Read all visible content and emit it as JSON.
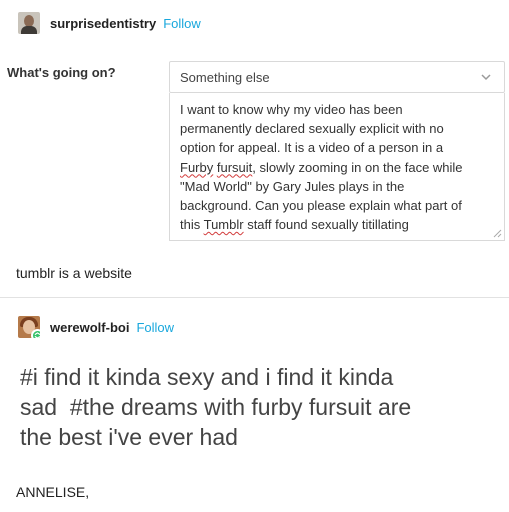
{
  "post1": {
    "username": "surprisedentistry",
    "follow_label": "Follow"
  },
  "form": {
    "label": "What's going on?",
    "select_value": "Something else",
    "message": {
      "line1": "I want to know why my video has been",
      "line2": "permanently declared sexually explicit with no",
      "line3": "option for appeal. It is a video of a person in a",
      "line4_word1": "Furby",
      "line4_word2": "fursuit",
      "line4_rest": ", slowly zooming in on the face while",
      "line5": "\"Mad World\" by Gary Jules plays in the",
      "line6": "background. Can you please explain what part of",
      "line7_pre": "this ",
      "line7_word": "Tumblr",
      "line7_rest": " staff found sexually titillating"
    }
  },
  "comment": "tumblr is a website",
  "post2": {
    "username": "werewolf-boi",
    "follow_label": "Follow",
    "body_line1": "#i find it kinda sexy and i find it kinda",
    "body_line2": "sad  #the dreams with furby fursuit are",
    "body_line3": "the best i've ever had",
    "signoff": "ANNELISE,"
  },
  "colors": {
    "follow": "#18a7dc",
    "reblog_badge": "#36c26a",
    "spellcheck": "#d23b3b"
  }
}
